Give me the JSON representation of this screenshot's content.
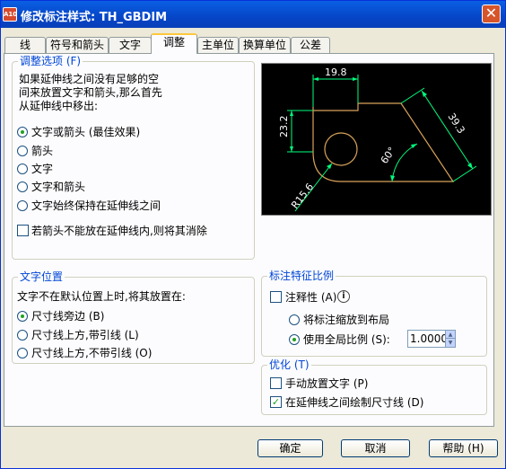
{
  "window": {
    "title": "修改标注样式: TH_GBDIM",
    "app_icon": "A10",
    "close": "✕"
  },
  "tabs": [
    "线",
    "符号和箭头",
    "文字",
    "调整",
    "主单位",
    "换算单位",
    "公差"
  ],
  "fit_options": {
    "legend": "调整选项 (F)",
    "description": [
      "如果延伸线之间没有足够的空",
      "间来放置文字和箭头,那么首先",
      "从延伸线中移出:"
    ],
    "options": [
      "文字或箭头 (最佳效果)",
      "箭头",
      "文字",
      "文字和箭头",
      "文字始终保持在延伸线之间"
    ],
    "selected_index": 0,
    "suppress_arrows_label": "若箭头不能放在延伸线内,则将其消除",
    "suppress_arrows_checked": false
  },
  "text_placement": {
    "legend": "文字位置",
    "description": "文字不在默认位置上时,将其放置在:",
    "options": [
      "尺寸线旁边 (B)",
      "尺寸线上方,带引线 (L)",
      "尺寸线上方,不带引线 (O)"
    ],
    "selected_index": 0
  },
  "scale": {
    "legend": "标注特征比例",
    "annotative_label": "注释性 (A)",
    "annotative_checked": false,
    "options": [
      "将标注缩放到布局",
      "使用全局比例 (S):"
    ],
    "selected_index": 1,
    "global_scale_value": "1.0000"
  },
  "fine_tuning": {
    "legend": "优化 (T)",
    "manual_text_label": "手动放置文字 (P)",
    "manual_text_checked": false,
    "draw_dim_line_label": "在延伸线之间绘制尺寸线 (D)",
    "draw_dim_line_checked": true
  },
  "preview": {
    "dim_top": "19.8",
    "dim_left": "23.2",
    "dim_right": "39.3",
    "dim_angle": "60°",
    "dim_radius": "R15.6",
    "colors": {
      "background": "#000000",
      "dimension": "#00ff7f",
      "geometry": "#d9a35a",
      "text": "#ffffff"
    }
  },
  "buttons": {
    "ok": "确定",
    "cancel": "取消",
    "help": "帮助 (H)"
  }
}
